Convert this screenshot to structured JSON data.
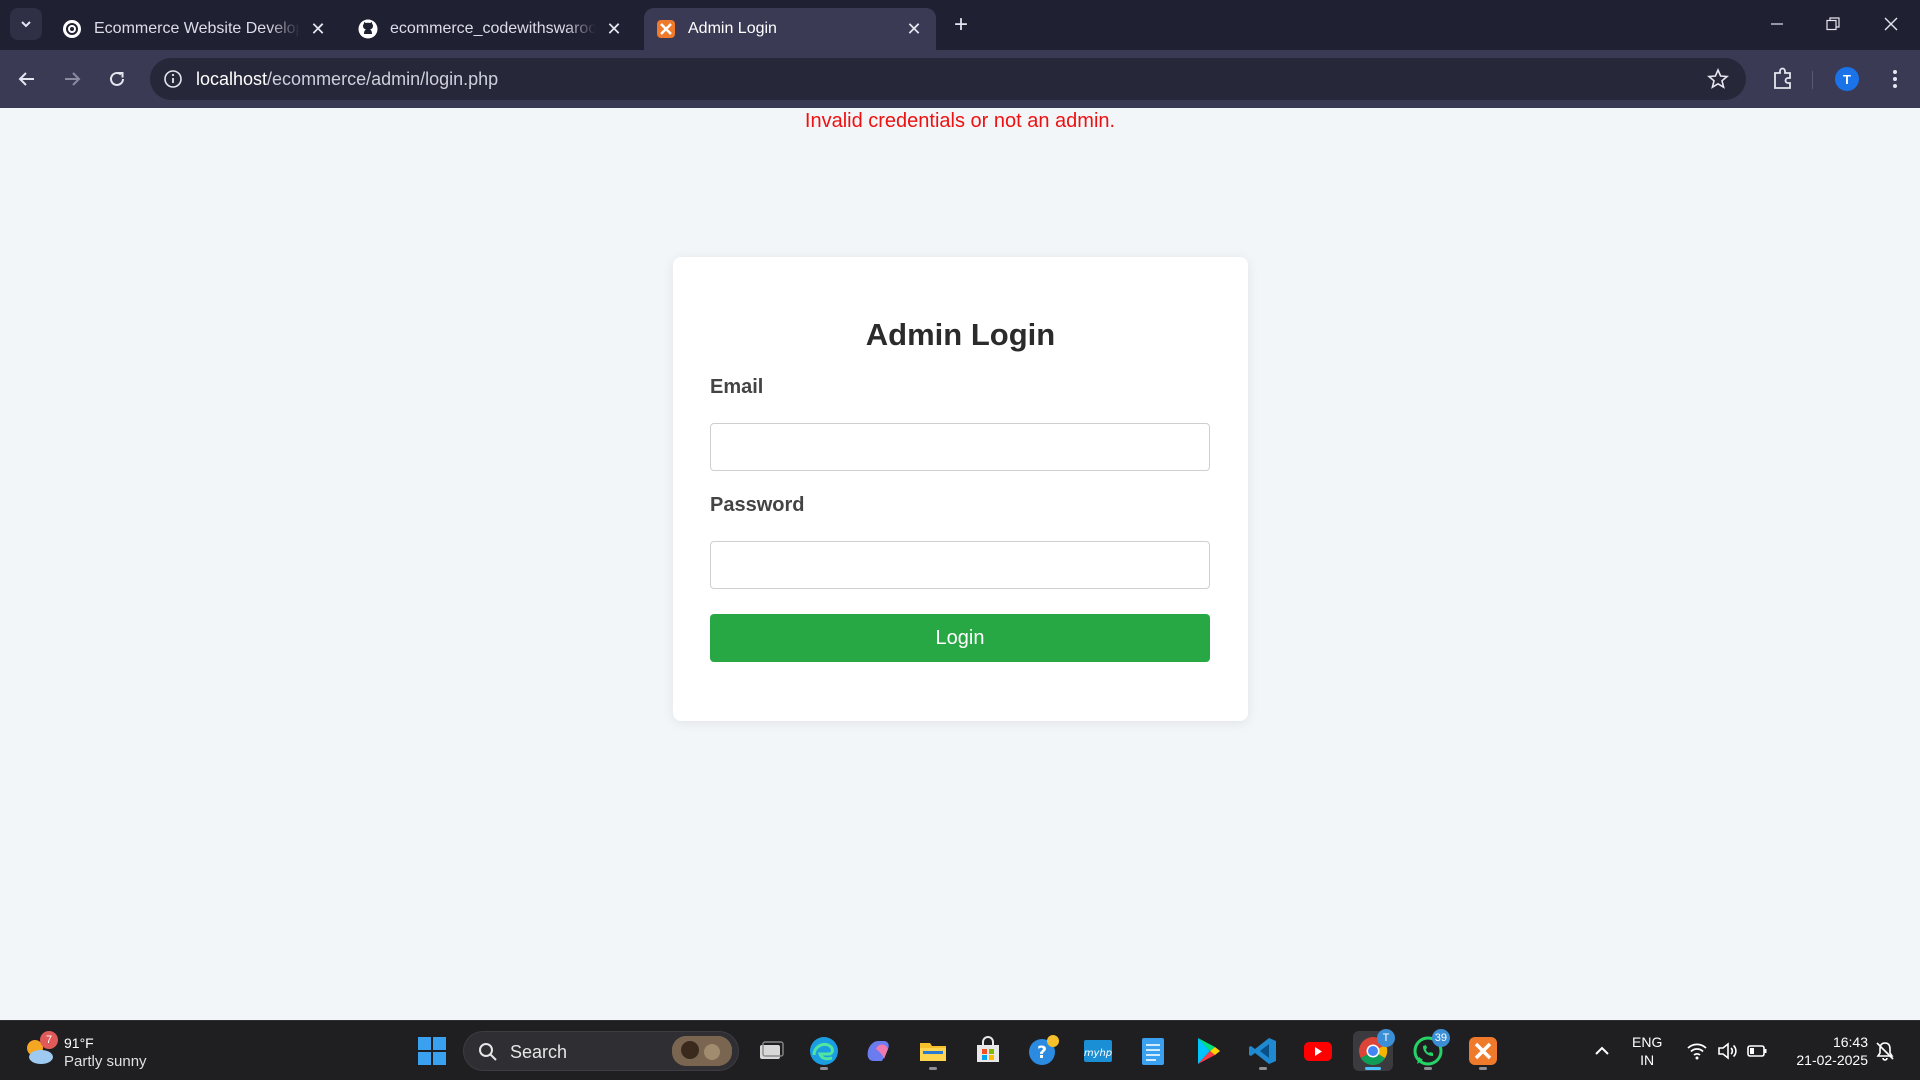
{
  "browser": {
    "tabs": [
      {
        "title": "Ecommerce Website Developm",
        "favicon": "chatgpt-icon"
      },
      {
        "title": "ecommerce_codewithswaroop/",
        "favicon": "github-icon"
      },
      {
        "title": "Admin Login",
        "favicon": "xampp-icon",
        "active": true
      }
    ],
    "url": {
      "host": "localhost",
      "path": "/ecommerce/admin/login.php"
    },
    "profile_initial": "T"
  },
  "page": {
    "error_message": "Invalid credentials or not an admin.",
    "form": {
      "title": "Admin Login",
      "email_label": "Email",
      "email_value": "",
      "password_label": "Password",
      "password_value": "",
      "submit_label": "Login"
    },
    "colors": {
      "error": "#ee1111",
      "button": "#28a745",
      "background": "#f3f6f9"
    }
  },
  "taskbar": {
    "weather": {
      "temp": "91°F",
      "condition": "Partly sunny",
      "badge": "7"
    },
    "search_placeholder": "Search",
    "apps": [
      {
        "name": "windows-start-icon"
      },
      {
        "name": "task-view-icon"
      },
      {
        "name": "edge-icon"
      },
      {
        "name": "copilot-icon"
      },
      {
        "name": "file-explorer-icon"
      },
      {
        "name": "ms-store-icon"
      },
      {
        "name": "get-help-icon"
      },
      {
        "name": "myhp-icon"
      },
      {
        "name": "notepad-icon"
      },
      {
        "name": "play-store-icon"
      },
      {
        "name": "vscode-icon"
      },
      {
        "name": "youtube-icon"
      },
      {
        "name": "chrome-icon",
        "badge": "T"
      },
      {
        "name": "whatsapp-icon",
        "badge": "39"
      },
      {
        "name": "xampp-icon"
      }
    ],
    "language": {
      "line1": "ENG",
      "line2": "IN"
    },
    "time": "16:43",
    "date": "21-02-2025"
  }
}
